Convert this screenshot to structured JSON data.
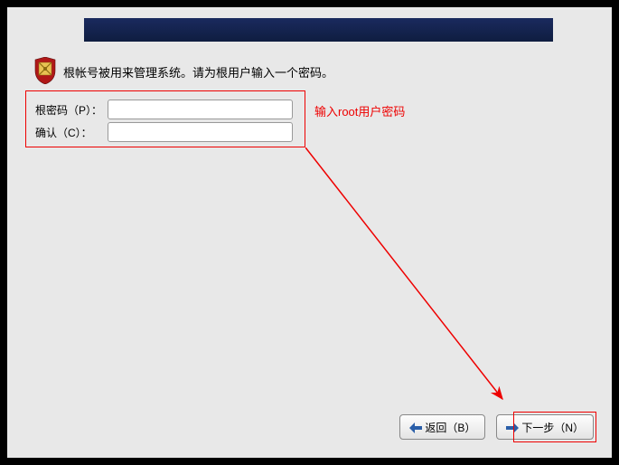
{
  "description": "根帐号被用来管理系统。请为根用户输入一个密码。",
  "form": {
    "password_label": "根密码（P）：",
    "confirm_label": "确认（C）：",
    "password_value": "",
    "confirm_value": ""
  },
  "annotation": "输入root用户密码",
  "buttons": {
    "back": "返回（B）",
    "next": "下一步（N）"
  }
}
